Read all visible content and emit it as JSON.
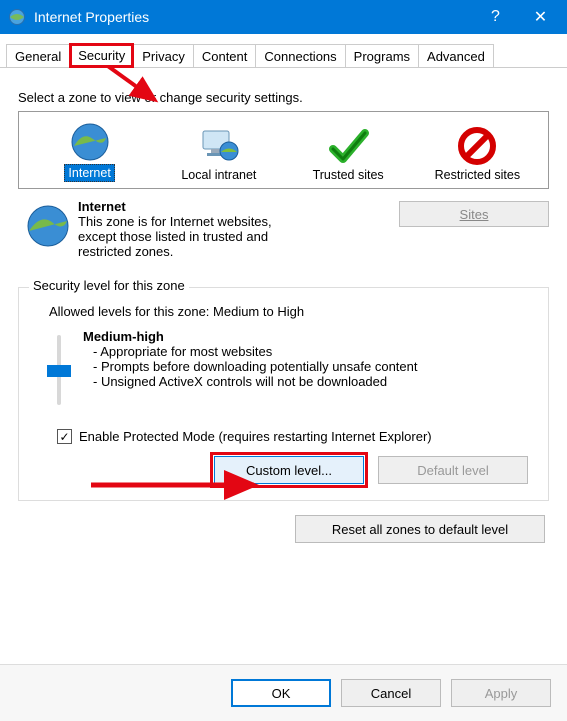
{
  "window": {
    "title": "Internet Properties",
    "help_glyph": "?",
    "close_glyph": "✕"
  },
  "tabs": {
    "general": "General",
    "security": "Security",
    "privacy": "Privacy",
    "content": "Content",
    "connections": "Connections",
    "programs": "Programs",
    "advanced": "Advanced"
  },
  "content": {
    "instruction": "Select a zone to view or change security settings.",
    "zones": {
      "internet": "Internet",
      "local_intranet": "Local intranet",
      "trusted_sites": "Trusted sites",
      "restricted_sites": "Restricted sites"
    },
    "zone_desc": {
      "title": "Internet",
      "body": "This zone is for Internet websites, except those listed in trusted and restricted zones."
    },
    "sites_btn": "Sites",
    "group_legend": "Security level for this zone",
    "allowed_levels": "Allowed levels for this zone: Medium to High",
    "level_name": "Medium-high",
    "bullets": {
      "b1": "- Appropriate for most websites",
      "b2": "- Prompts before downloading potentially unsafe content",
      "b3": "- Unsigned ActiveX controls will not be downloaded"
    },
    "protected_mode": "Enable Protected Mode (requires restarting Internet Explorer)",
    "custom_level": "Custom level...",
    "default_level": "Default level",
    "reset_all": "Reset all zones to default level"
  },
  "footer": {
    "ok": "OK",
    "cancel": "Cancel",
    "apply": "Apply"
  }
}
